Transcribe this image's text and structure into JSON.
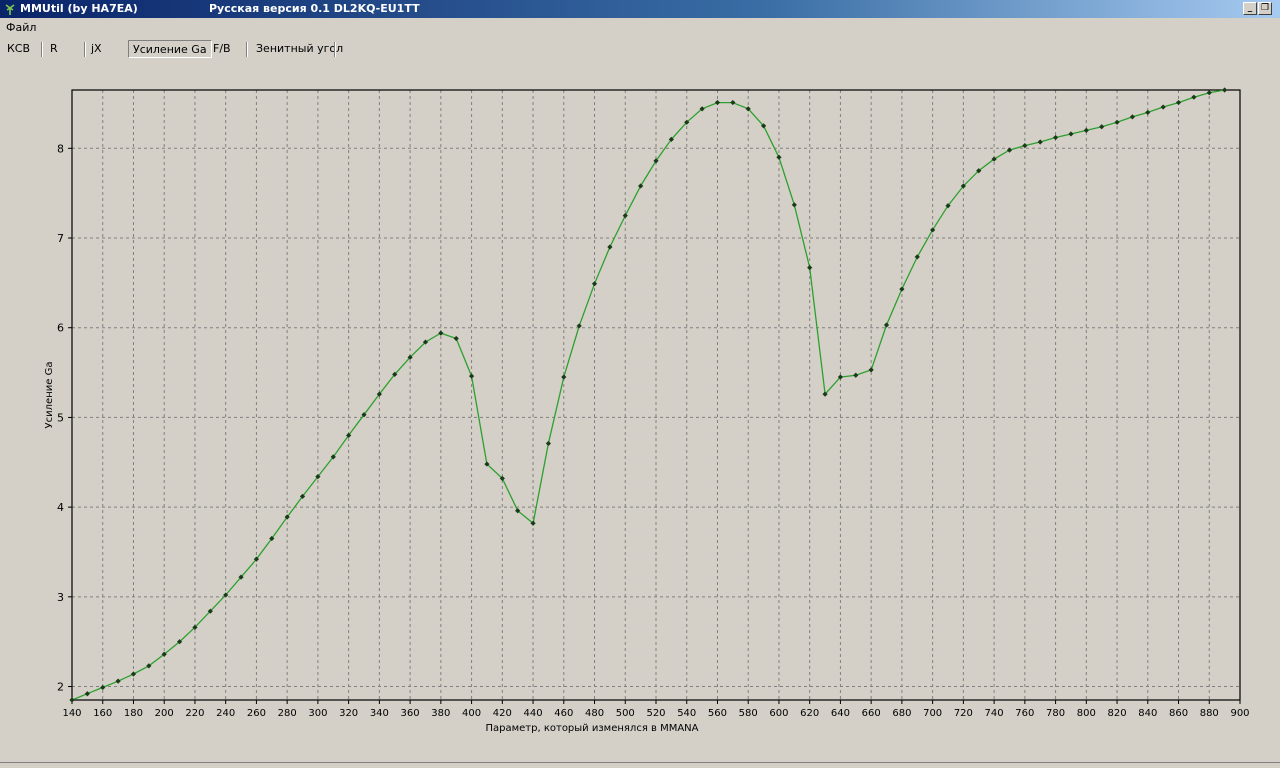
{
  "window": {
    "title": "MMUtil (by HA7EA)",
    "subtitle": "Русская версия 0.1 DL2KQ-EU1TT",
    "minimize_label": "_",
    "restore_label": "❐",
    "icon": "antenna-icon"
  },
  "menu": {
    "file": "Файл"
  },
  "tabs": [
    {
      "label": "КСВ",
      "active": false
    },
    {
      "label": "R",
      "active": false
    },
    {
      "label": "jX",
      "active": false
    },
    {
      "label": "Усиление Ga",
      "active": true
    },
    {
      "label": "F/B",
      "active": false
    },
    {
      "label": "Зенитный угол",
      "active": false
    }
  ],
  "colors": {
    "line": "#2ca02c",
    "marker": "#1a3a1a",
    "grid": "#808080"
  },
  "chart_data": {
    "type": "line",
    "title": "",
    "xlabel": "Параметр, который изменялся в MMANA",
    "ylabel": "Усиление Ga",
    "xlim": [
      140,
      900
    ],
    "ylim": [
      1.85,
      8.65
    ],
    "x_ticks": [
      140,
      160,
      180,
      200,
      220,
      240,
      260,
      280,
      300,
      320,
      340,
      360,
      380,
      400,
      420,
      440,
      460,
      480,
      500,
      520,
      540,
      560,
      580,
      600,
      620,
      640,
      660,
      680,
      700,
      720,
      740,
      760,
      780,
      800,
      820,
      840,
      860,
      880,
      900
    ],
    "y_ticks": [
      2,
      3,
      4,
      5,
      6,
      7,
      8
    ],
    "grid": true,
    "series": [
      {
        "x": [
          140,
          150,
          160,
          170,
          180,
          190,
          200,
          210,
          220,
          230,
          240,
          250,
          260,
          270,
          280,
          290,
          300,
          310,
          320,
          330,
          340,
          350,
          360,
          370,
          380,
          390,
          400,
          410,
          420,
          430,
          440,
          450,
          460,
          470,
          480,
          490,
          500,
          510,
          520,
          530,
          540,
          550,
          560,
          570,
          580,
          590,
          600,
          610,
          620,
          630,
          640,
          650,
          660,
          670,
          680,
          690,
          700,
          710,
          720,
          730,
          740,
          750,
          760,
          770,
          780,
          790,
          800,
          810,
          820,
          830,
          840,
          850,
          860,
          870,
          880,
          890
        ],
        "y": [
          1.85,
          1.92,
          1.99,
          2.06,
          2.14,
          2.23,
          2.36,
          2.5,
          2.66,
          2.84,
          3.02,
          3.22,
          3.42,
          3.65,
          3.89,
          4.12,
          4.34,
          4.56,
          4.8,
          5.03,
          5.26,
          5.48,
          5.67,
          5.84,
          5.94,
          5.88,
          5.46,
          4.48,
          4.32,
          3.96,
          3.82,
          4.71,
          5.45,
          6.02,
          6.49,
          6.9,
          7.25,
          7.58,
          7.86,
          8.1,
          8.29,
          8.44,
          8.51,
          8.51,
          8.44,
          8.25,
          7.9,
          7.37,
          6.67,
          5.26,
          5.45,
          5.47,
          5.53,
          6.03,
          6.43,
          6.79,
          7.09,
          7.36,
          7.58,
          7.75,
          7.88,
          7.98,
          8.03,
          8.07,
          8.12,
          8.16,
          8.2,
          8.24,
          8.29,
          8.35,
          8.4,
          8.46,
          8.51,
          8.57,
          8.62,
          8.65
        ]
      }
    ]
  }
}
